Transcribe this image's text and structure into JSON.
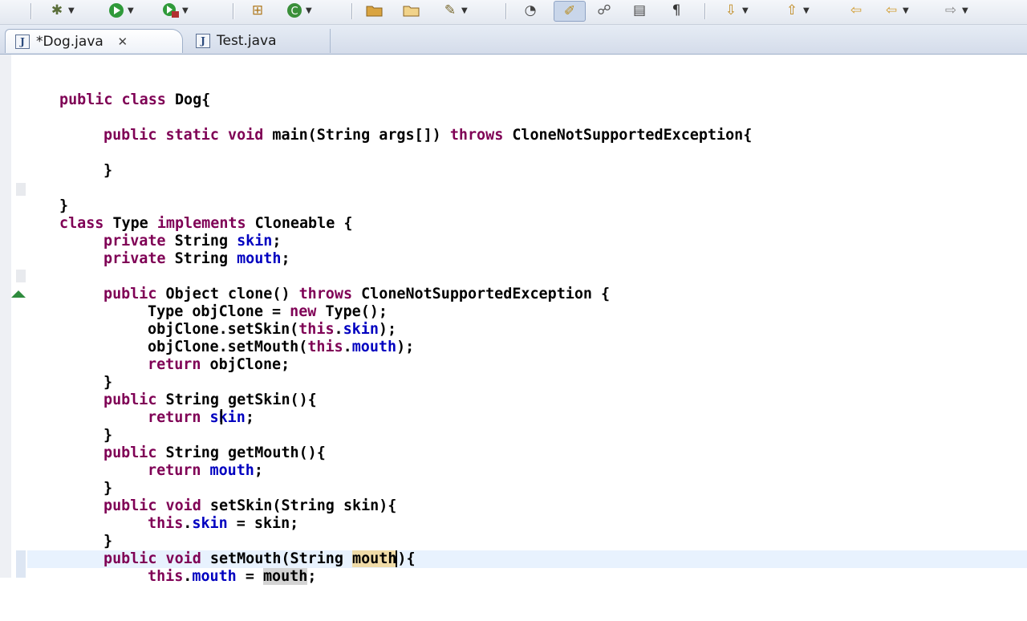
{
  "toolbar": {
    "icons": [
      "debug-icon",
      "run-icon",
      "external-tools-icon",
      "new-package-icon",
      "new-class-icon",
      "open-type-icon",
      "open-task-icon",
      "search-icon",
      "toggle-mark-occurrences-icon",
      "highlight-icon",
      "show-whitespace-icon",
      "block-selection-icon",
      "paragraph-icon",
      "next-annotation-icon",
      "previous-annotation-icon",
      "last-edit-icon",
      "back-icon",
      "forward-icon"
    ]
  },
  "tabs": [
    {
      "label": "*Dog.java",
      "active": true,
      "icon": "J"
    },
    {
      "label": "Test.java",
      "active": false,
      "icon": "J"
    }
  ],
  "code": {
    "line_public_class": "public class Dog{",
    "line_main_method": "public static void main(String args[]) throws CloneNotSupportedException{",
    "line_main_close": "}",
    "line_class_close": "}",
    "line_class_type": "class Type implements Cloneable {",
    "line_field_skin": "private String skin;",
    "line_field_mouth": "private String mouth;",
    "line_clone_sig": "public Object clone() throws CloneNotSupportedException {",
    "line_clone_new": "Type objClone = new Type();",
    "line_clone_setskin": "objClone.setSkin(this.skin);",
    "line_clone_setmouth": "objClone.setMouth(this.mouth);",
    "line_clone_return": "return objClone;",
    "line_clone_close": "}",
    "line_getskin_sig": "public String getSkin(){",
    "line_getskin_return": "return skin;",
    "line_getskin_close": "}",
    "line_getmouth_sig": "public String getMouth(){",
    "line_getmouth_return": "return mouth;",
    "line_getmouth_close": "}",
    "line_setskin_sig": "public void setSkin(String skin){",
    "line_setskin_body": "this.skin = skin;",
    "line_setskin_close": "}",
    "line_setmouth_sig": "public void setMouth(String mouth){",
    "line_setmouth_body": "this.mouth = mouth;"
  },
  "colors": {
    "keyword": "#7f0055",
    "field": "#0000c0",
    "occurrence": "#f0dca8",
    "current_line": "#e8f2fe"
  }
}
